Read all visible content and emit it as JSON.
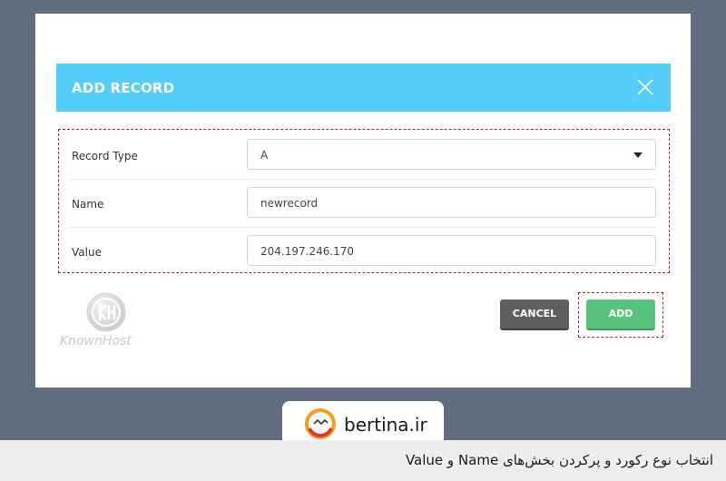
{
  "dialog": {
    "title": "ADD RECORD",
    "header_color": "#55cdfa"
  },
  "form": {
    "record_type": {
      "label": "Record Type",
      "value": "A"
    },
    "name": {
      "label": "Name",
      "value": "newrecord"
    },
    "value": {
      "label": "Value",
      "value": "204.197.246.170"
    }
  },
  "buttons": {
    "cancel": "CANCEL",
    "add": "ADD"
  },
  "watermark": {
    "text": "KnownHost"
  },
  "brand": {
    "name": "bertina.ir"
  },
  "caption": "انتخاب نوع رکورد و پرکردن بخش‌های Name و Value",
  "colors": {
    "highlight": "#9c2b3a",
    "add_button": "#5bc27e",
    "cancel_button": "#5f5f5f"
  }
}
